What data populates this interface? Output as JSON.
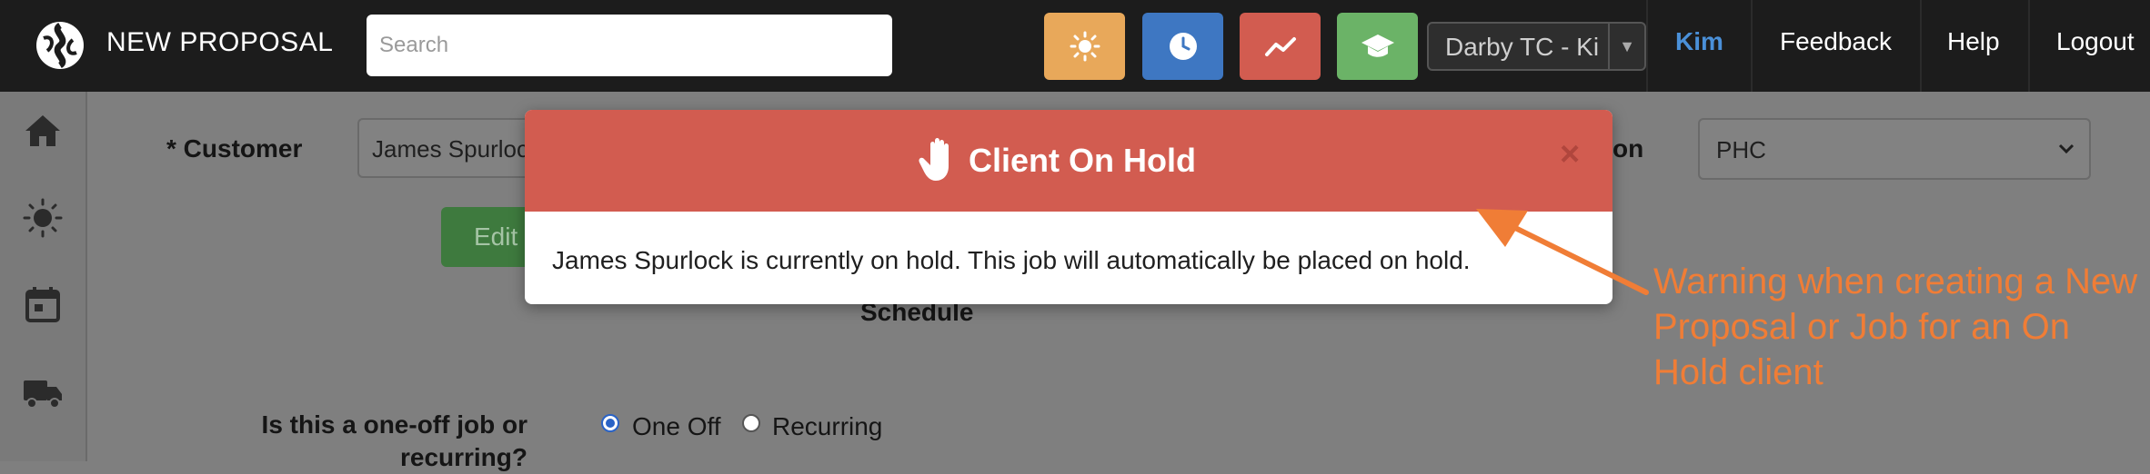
{
  "topbar": {
    "app_title": "NEW PROPOSAL",
    "search_placeholder": "Search",
    "company_select": "Darby TC - Ki",
    "user": "Kim",
    "nav": [
      "Feedback",
      "Help",
      "Logout"
    ],
    "quick_buttons": [
      {
        "icon": "sun-icon",
        "color": "#e8a85a"
      },
      {
        "icon": "clock-icon",
        "color": "#3e77c2"
      },
      {
        "icon": "trend-icon",
        "color": "#d25c50"
      },
      {
        "icon": "graduation-cap-icon",
        "color": "#6bb367"
      }
    ]
  },
  "sidebar": {
    "icons": [
      "home-icon",
      "sun-icon",
      "calendar-icon",
      "truck-icon"
    ]
  },
  "form": {
    "customer_label": "* Customer",
    "customer_value": "James Spurlock",
    "location_label_fragment": "on",
    "location_value": "PHC",
    "edit_label": "Edit",
    "schedule_label": "Schedule",
    "job_type_question": "Is this a one-off job or recurring?",
    "job_type_options": [
      "One Off",
      "Recurring"
    ],
    "job_type_selected": "One Off"
  },
  "modal": {
    "title": "Client On Hold",
    "close": "×",
    "message": "James Spurlock is currently on hold. This job will automatically be placed on hold."
  },
  "annotation": {
    "text": "Warning when creating a New Proposal or Job for an On Hold client",
    "color": "#f07d36"
  },
  "colors": {
    "modal_header": "#d25c50",
    "topbar": "#1c1c1c",
    "overlay": "#7f7f7f"
  }
}
